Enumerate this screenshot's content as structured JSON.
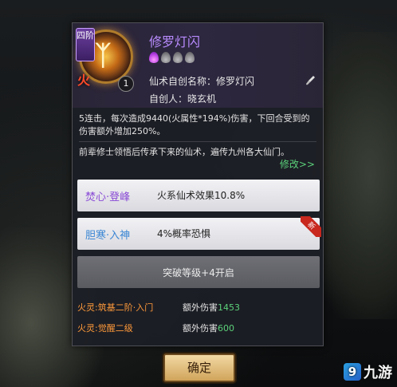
{
  "skill": {
    "tier_label": "四阶",
    "element_char": "火",
    "count": "1",
    "name": "修罗灯闪",
    "flames_total": 4,
    "flames_active": 1,
    "created_name_label": "仙术自创名称：修罗灯闪",
    "creator_label": "自创人：晓玄机"
  },
  "description": {
    "effect": "5连击，每次造成9440(火属性*194%)伤害，下回合受到的伤害额外增加250%。",
    "lore": "前辈修士领悟后传承下来的仙术，遍传九州各大仙门。",
    "modify_link": "修改>>"
  },
  "traits": [
    {
      "name": "焚心·登峰",
      "effect": "火系仙术效果10.8%",
      "is_new": false
    },
    {
      "name": "胆寒·入神",
      "effect": "4%概率恐惧",
      "is_new": true,
      "new_badge": "新"
    }
  ],
  "locked_slot": {
    "label": "突破等级+4开启"
  },
  "bonuses": [
    {
      "label": "火灵:筑基二阶·入门",
      "name": "额外伤害",
      "value": "1453"
    },
    {
      "label": "火灵:觉醒二级",
      "name": "额外伤害",
      "value": "600"
    }
  ],
  "confirm_button": "确定",
  "watermark": {
    "mark": "9",
    "text": "九游"
  },
  "colors": {
    "skill_name": "#b98cff",
    "flame_active": "#b23de0",
    "green_text": "#5bd17a",
    "orange_text": "#ff9a3a",
    "new_badge": "#c8281e"
  }
}
